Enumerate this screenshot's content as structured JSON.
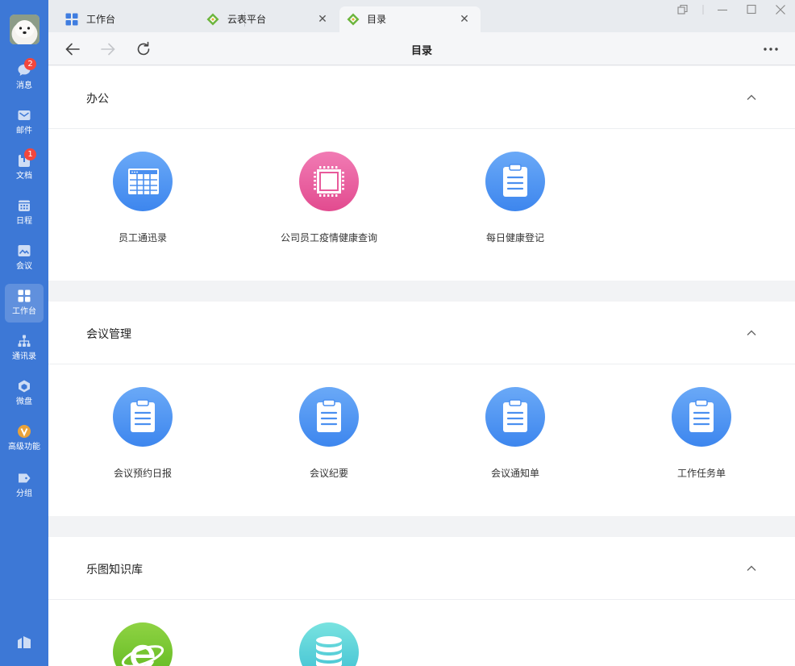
{
  "sidebar": {
    "items": [
      {
        "label": "消息",
        "icon": "chat-bubble-icon",
        "badge": "2"
      },
      {
        "label": "邮件",
        "icon": "mail-icon",
        "badge": ""
      },
      {
        "label": "文档",
        "icon": "document-icon",
        "badge": "1"
      },
      {
        "label": "日程",
        "icon": "calendar-icon",
        "badge": ""
      },
      {
        "label": "会议",
        "icon": "meeting-icon",
        "badge": ""
      },
      {
        "label": "工作台",
        "icon": "workbench-grid-icon",
        "badge": "",
        "active": true
      },
      {
        "label": "通讯录",
        "icon": "org-chart-icon",
        "badge": ""
      },
      {
        "label": "微盘",
        "icon": "cloud-drive-icon",
        "badge": ""
      },
      {
        "label": "高级功能",
        "icon": "premium-v-icon",
        "badge": ""
      },
      {
        "label": "分组",
        "icon": "tag-icon",
        "badge": ""
      }
    ]
  },
  "tabs": [
    {
      "label": "工作台",
      "icon": "workbench-grid-icon",
      "active": false
    },
    {
      "label": "云表平台",
      "icon": "cloud-table-icon",
      "active": false
    },
    {
      "label": "目录",
      "icon": "cloud-table-icon",
      "active": true
    }
  ],
  "toolbar": {
    "title": "目录"
  },
  "sections": [
    {
      "title": "办公",
      "apps": [
        {
          "label": "员工通迅录",
          "icon": "table-grid-icon",
          "color": "blue"
        },
        {
          "label": "公司员工疫情健康查询",
          "icon": "chip-icon",
          "color": "pink"
        },
        {
          "label": "每日健康登记",
          "icon": "clipboard-icon",
          "color": "blue"
        }
      ]
    },
    {
      "title": "会议管理",
      "apps": [
        {
          "label": "会议预约日报",
          "icon": "clipboard-icon",
          "color": "blue"
        },
        {
          "label": "会议纪要",
          "icon": "clipboard-icon",
          "color": "blue"
        },
        {
          "label": "会议通知单",
          "icon": "clipboard-icon",
          "color": "blue"
        },
        {
          "label": "工作任务单",
          "icon": "clipboard-icon",
          "color": "blue"
        }
      ]
    },
    {
      "title": "乐图知识库",
      "apps": [
        {
          "label": "",
          "icon": "browser-e-icon",
          "color": "green"
        },
        {
          "label": "",
          "icon": "database-icon",
          "color": "teal"
        }
      ]
    }
  ],
  "colors": {
    "sidebar": "#3d78d6",
    "accent_blue": "#4a90f0",
    "accent_pink": "#e85a9b",
    "accent_green": "#6cc02a",
    "badge": "#f2473d"
  }
}
